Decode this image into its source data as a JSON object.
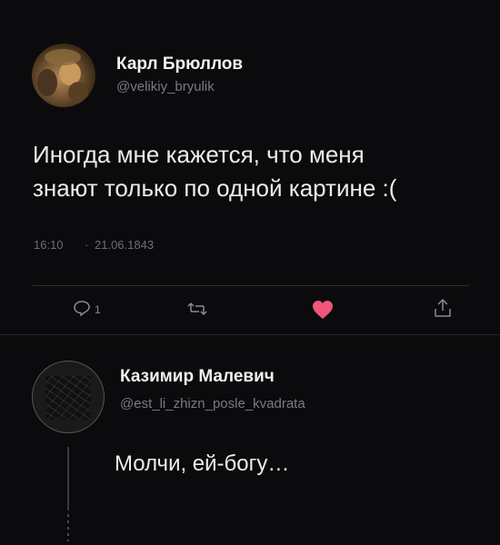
{
  "tweet": {
    "author_name": "Карл Брюллов",
    "handle": "@velikiy_bryulik",
    "text_line1": "Иногда мне кажется, что меня",
    "text_line2": "знают только по одной картине :(",
    "time": "16:10",
    "separator": "·",
    "date": "21.06.1843",
    "reply_count": "1",
    "avatar_icon": "portrait-painting-avatar"
  },
  "reply": {
    "author_name": "Казимир Малевич",
    "handle": "@est_li_zhizn_posle_kvadrata",
    "text": "Молчи, ей-богу…",
    "avatar_icon": "black-square-avatar"
  },
  "actions": {
    "reply_icon": "reply-icon",
    "retweet_icon": "retweet-icon",
    "like_icon": "heart-icon",
    "share_icon": "share-icon"
  },
  "colors": {
    "background": "#0b0b0d",
    "like": "#f0567a",
    "muted": "#7a7a80"
  }
}
